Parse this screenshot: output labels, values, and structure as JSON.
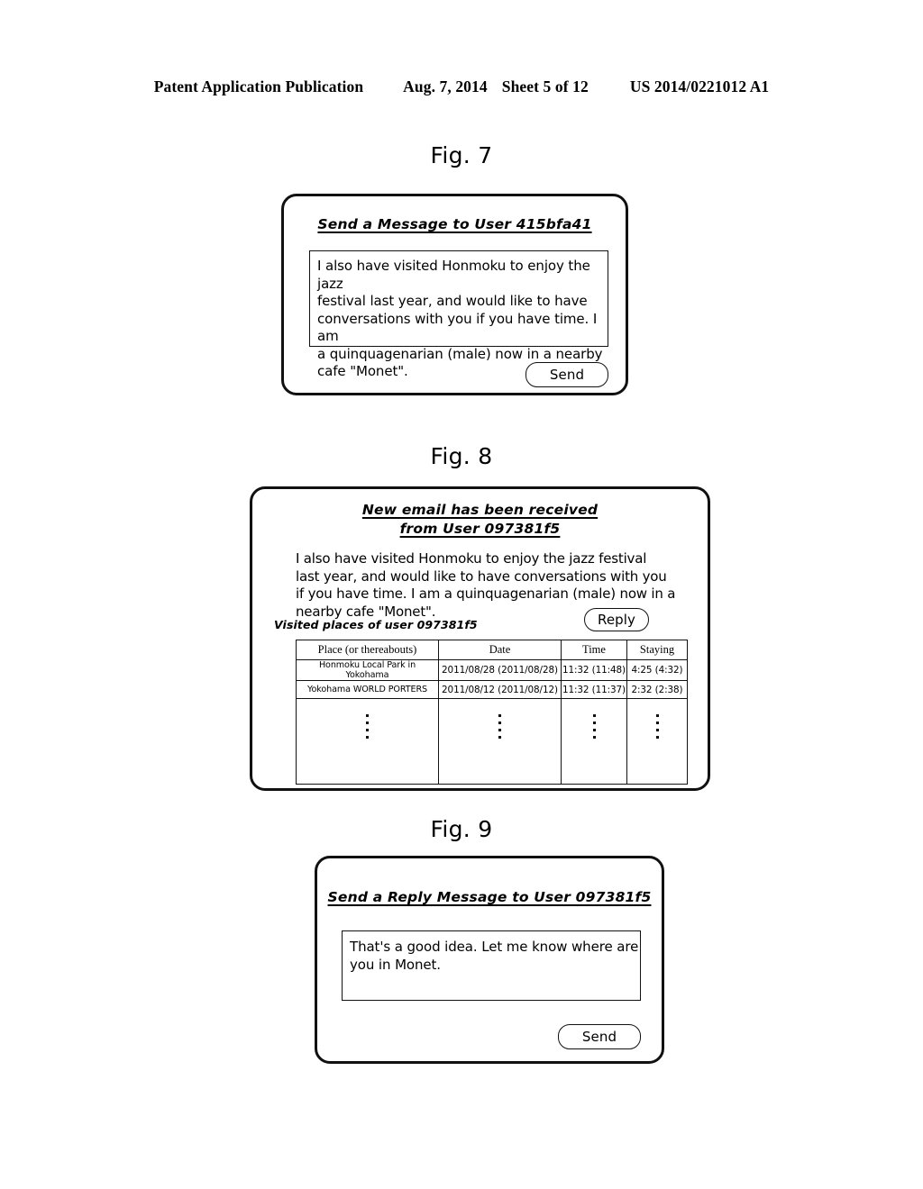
{
  "header": {
    "publication": "Patent Application Publication",
    "date": "Aug. 7, 2014",
    "sheet": "Sheet 5 of 12",
    "patent_number": "US 2014/0221012 A1"
  },
  "figures": [
    {
      "caption": "Fig. 7",
      "title": "Send a Message to User 415bfa41",
      "message": "I also have visited Honmoku to enjoy the jazz\nfestival last year, and would like to have\nconversations with you if you have time. I am\na quinquagenarian (male) now in a nearby\ncafe \"Monet\".",
      "button": "Send"
    },
    {
      "caption": "Fig. 8",
      "title_line1": "New email has been received",
      "title_line2": "from User 097381f5",
      "message": "I also have visited Honmoku to enjoy the jazz festival\nlast year, and would like to have conversations with you\nif you have time. I am a quinquagenarian (male) now in a\nnearby cafe \"Monet\".",
      "button": "Reply",
      "table_label": "Visited places of user 097381f5",
      "table": {
        "columns": [
          "Place (or thereabouts)",
          "Date",
          "Time",
          "Staying"
        ],
        "rows": [
          [
            "Honmoku Local Park in Yokohama",
            "2011/08/28 (2011/08/28)",
            "11:32 (11:48)",
            "4:25 (4:32)"
          ],
          [
            "Yokohama WORLD PORTERS",
            "2011/08/12 (2011/08/12)",
            "11:32 (11:37)",
            "2:32 (2:38)"
          ]
        ],
        "continuation": "vertical-ellipsis"
      }
    },
    {
      "caption": "Fig. 9",
      "title": "Send a Reply Message to User 097381f5",
      "message": "That's a good idea. Let me know where are\nyou in Monet.",
      "button": "Send"
    }
  ]
}
